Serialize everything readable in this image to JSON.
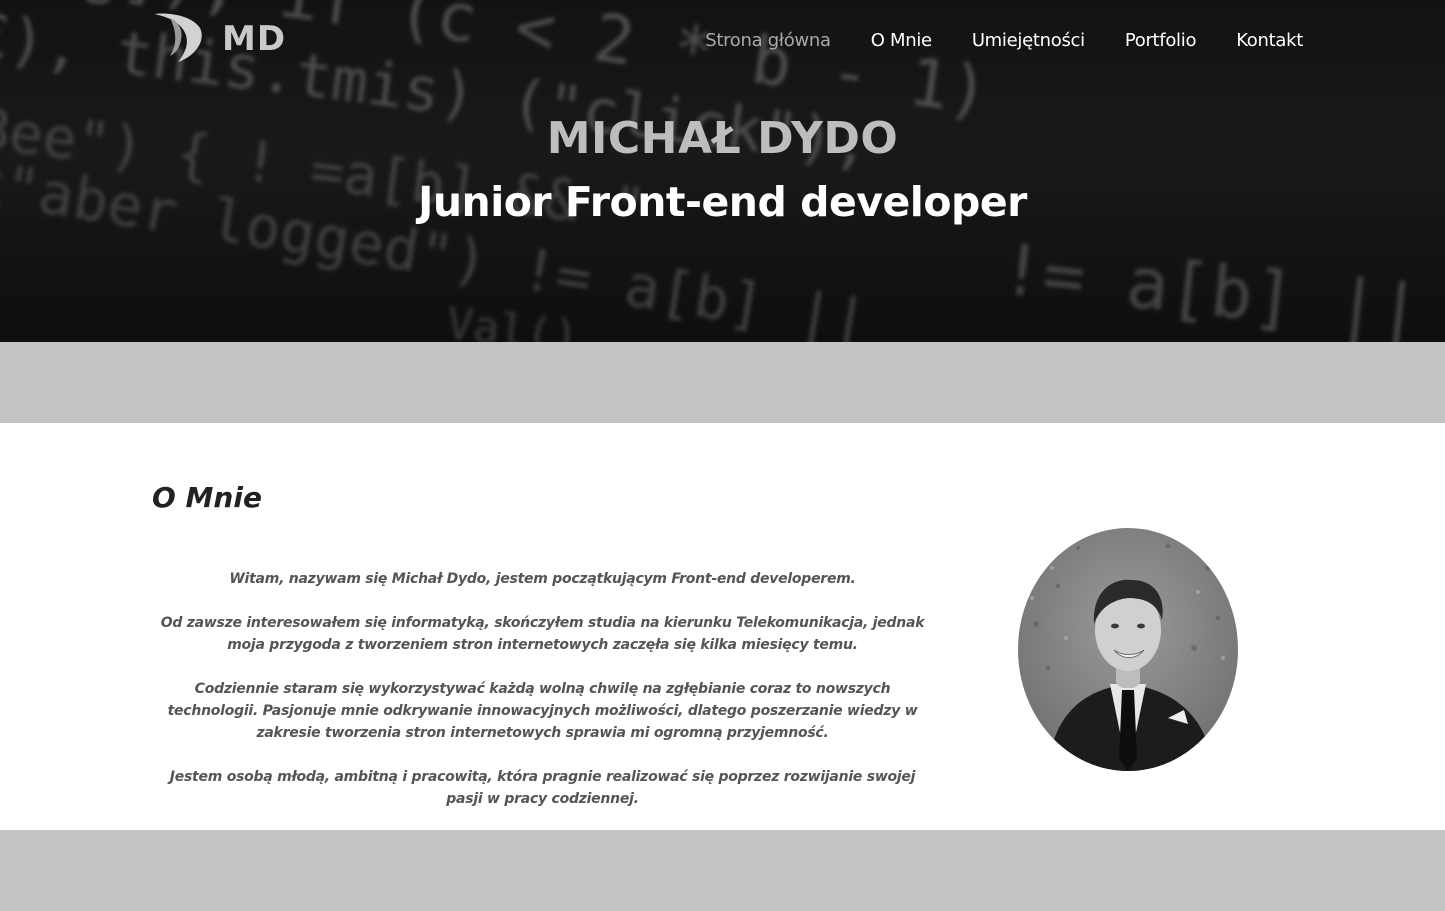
{
  "logo": {
    "text": "MD",
    "mark_icon": "swoosh-logo-icon"
  },
  "nav": {
    "items": [
      {
        "label": "Strona główna",
        "active": true
      },
      {
        "label": "O Mnie",
        "active": false
      },
      {
        "label": "Umiejętności",
        "active": false
      },
      {
        "label": "Portfolio",
        "active": false
      },
      {
        "label": "Kontakt",
        "active": false
      }
    ]
  },
  "hero": {
    "name": "MICHAŁ DYDO",
    "role": "Junior Front-end developer",
    "background_icon": "blurred-code-background"
  },
  "about": {
    "title": "O Mnie",
    "paragraphs": [
      "Witam, nazywam się Michał Dydo, jestem początkującym Front-end developerem.",
      "Od zawsze interesowałem się informatyką, skończyłem studia na kierunku Telekomunikacja, jednak moja przygoda z tworzeniem stron internetowych zaczęła się kilka miesięcy temu.",
      "Codziennie staram się wykorzystywać każdą wolną chwilę na zgłębianie coraz to nowszych technologii. Pasjonuje mnie odkrywanie innowacyjnych możliwości, dlatego poszerzanie wiedzy w zakresie tworzenia stron internetowych sprawia mi ogromną przyjemność.",
      "Jestem osobą młodą, ambitną i pracowitą, która pragnie realizować się poprzez rozwijanie swojej pasji w pracy codziennej."
    ],
    "photo_icon": "profile-photo"
  },
  "colors": {
    "band": "#c4c4c4",
    "nav_active": "#a9a9a9",
    "text_body": "#555555",
    "title": "#222222"
  }
}
